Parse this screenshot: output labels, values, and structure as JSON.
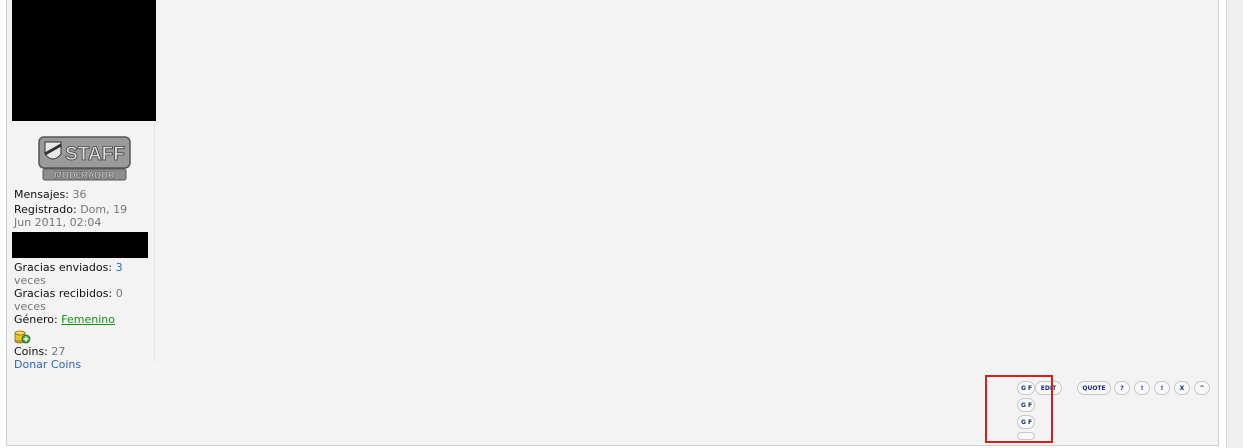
{
  "profile": {
    "badge": {
      "title": "STAFF",
      "subtitle": "MODERADOR"
    },
    "messages_label": "Mensajes:",
    "messages_value": "36",
    "registered_label": "Registrado:",
    "registered_value_1": "Dom, 19",
    "registered_value_2": "Jun 2011, 02:04",
    "thanks_sent_label": "Gracias enviados:",
    "thanks_sent_value": "3",
    "thanks_sent_unit": "veces",
    "thanks_received_label": "Gracias recibidos:",
    "thanks_received_value": "0",
    "thanks_received_unit": "veces",
    "gender_label": "Género:",
    "gender_value": "Femenino",
    "coins_label": "Coins:",
    "coins_value": "27",
    "donate_link": "Donar Coins"
  },
  "post_buttons": {
    "gf_1": "G F",
    "edit": "EDIT",
    "quote": "QUOTE",
    "help": "?",
    "report": "!",
    "warn": "!",
    "delete": "X",
    "top": "^",
    "gf_2": "G F",
    "gf_3": "G F"
  },
  "colors": {
    "link": "#2f67b2",
    "gender_link": "#1a8f1a",
    "highlight": "#d02020",
    "button_text": "#1a2d6e"
  }
}
